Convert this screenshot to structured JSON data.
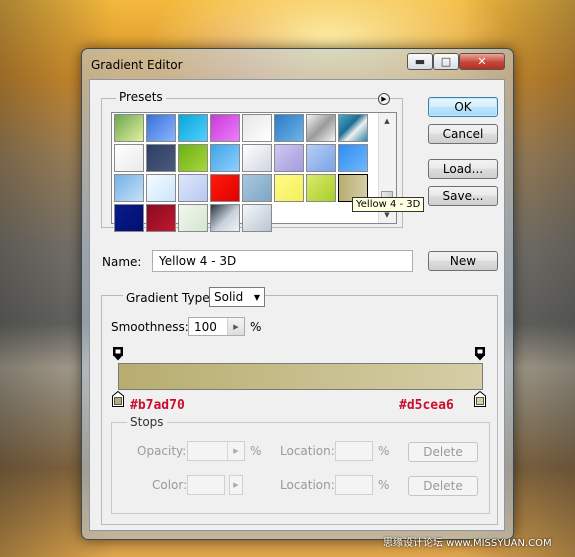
{
  "window": {
    "title": "Gradient Editor",
    "controls": {
      "minimize": "▬",
      "maximize": "□",
      "close": "✕"
    }
  },
  "presets": {
    "label": "Presets",
    "menu_icon": "triangle-right-icon",
    "tooltip": "Yellow 4 - 3D",
    "swatches": [
      {
        "name": "green-yellow",
        "css": "linear-gradient(135deg,#6aa84f,#e6f0a0)"
      },
      {
        "name": "blue",
        "css": "linear-gradient(135deg,#3b6fd8,#89b6ff)"
      },
      {
        "name": "cyan",
        "css": "linear-gradient(135deg,#0aa6d8,#4fd0ff)"
      },
      {
        "name": "magenta",
        "css": "linear-gradient(135deg,#c63ad6,#f07cff)"
      },
      {
        "name": "silver",
        "css": "linear-gradient(135deg,#e6e6e6,#ffffff)"
      },
      {
        "name": "steel-blue",
        "css": "linear-gradient(135deg,#2b7bc6,#6fb3ea)"
      },
      {
        "name": "chrome",
        "css": "linear-gradient(135deg,#f4f4f4,#9a9a9a 50%,#f4f4f4)"
      },
      {
        "name": "teal-stripe",
        "css": "linear-gradient(135deg,#4aa7c9,#1d6f93 40%,#f0f0f0 60%,#2a86a8)"
      },
      {
        "name": "white",
        "css": "linear-gradient(135deg,#ffffff,#eaeaea)"
      },
      {
        "name": "navy",
        "css": "linear-gradient(135deg,#2e3e63,#4b5b80)"
      },
      {
        "name": "green",
        "css": "linear-gradient(135deg,#6bb116,#a8d63b)"
      },
      {
        "name": "sky",
        "css": "linear-gradient(135deg,#3fa4e6,#8fd0ff)"
      },
      {
        "name": "pale-silver",
        "css": "linear-gradient(135deg,#ffffff,#cfd6df)"
      },
      {
        "name": "lavender",
        "css": "linear-gradient(135deg,#cfc8f0,#a59be0)"
      },
      {
        "name": "powder-blue",
        "css": "linear-gradient(135deg,#b6cdf5,#7aa3e8)"
      },
      {
        "name": "bright-blue",
        "css": "linear-gradient(135deg,#2f8cf0,#6fb8ff)"
      },
      {
        "name": "light-blue",
        "css": "linear-gradient(135deg,#75b2e6,#c4e0f8)"
      },
      {
        "name": "ice",
        "css": "linear-gradient(135deg,#f6fbff,#c9e6fb)"
      },
      {
        "name": "periwinkle",
        "css": "linear-gradient(135deg,#dfe8fb,#b5c8f2)"
      },
      {
        "name": "red",
        "css": "linear-gradient(135deg,#ff1a0a,#e00000)"
      },
      {
        "name": "blue-grey",
        "css": "linear-gradient(135deg,#a7c7e0,#7fa6c4)"
      },
      {
        "name": "yellow",
        "css": "linear-gradient(135deg,#fff98a,#f5f05a)"
      },
      {
        "name": "yellow-green",
        "css": "linear-gradient(135deg,#dbe86c,#a6cf2a)"
      },
      {
        "name": "yellow-4-3d",
        "css": "linear-gradient(90deg,#b7ad70,#d5cea6)"
      },
      {
        "name": "dark-blue",
        "css": "linear-gradient(135deg,#0a1a8c,#001070)"
      },
      {
        "name": "crimson",
        "css": "linear-gradient(135deg,#8a0a1e,#c01830)"
      },
      {
        "name": "mint-white",
        "css": "linear-gradient(135deg,#f2f7ee,#d4e6d0)"
      },
      {
        "name": "dark-chrome",
        "css": "linear-gradient(135deg,#2a3440,#c8d2dc 55%,#f0f4f8)"
      },
      {
        "name": "pale-steel",
        "css": "linear-gradient(135deg,#f4f7fa,#b9c6d2)"
      }
    ]
  },
  "buttons": {
    "ok": "OK",
    "cancel": "Cancel",
    "load": "Load...",
    "save": "Save...",
    "new": "New"
  },
  "name_field": {
    "label": "Name:",
    "value": "Yellow 4 - 3D"
  },
  "gradient": {
    "type_label": "Gradient Type:",
    "type_value": "Solid",
    "smoothness_label": "Smoothness:",
    "smoothness_value": "100",
    "smoothness_unit": "%",
    "start_color": "#b7ad70",
    "end_color": "#d5cea6",
    "start_hex_label": "#b7ad70",
    "end_hex_label": "#d5cea6"
  },
  "stops": {
    "label": "Stops",
    "opacity_label": "Opacity:",
    "opacity_unit": "%",
    "location_label": "Location:",
    "location_unit": "%",
    "color_label": "Color:",
    "delete_label": "Delete"
  },
  "watermark": "思缘设计论坛 www.MISSYUAN.COM"
}
